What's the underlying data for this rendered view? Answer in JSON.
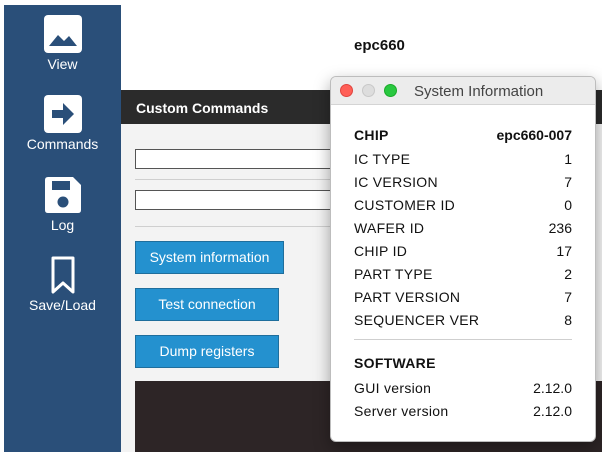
{
  "sidebar": {
    "items": [
      {
        "label": "View",
        "icon": "image-icon"
      },
      {
        "label": "Commands",
        "icon": "arrow-right-icon"
      },
      {
        "label": "Log",
        "icon": "floppy-disk-icon"
      },
      {
        "label": "Save/Load",
        "icon": "bookmark-icon"
      }
    ]
  },
  "device": {
    "name": "epc660"
  },
  "panel": {
    "title": "Custom Commands",
    "buttons": [
      {
        "label": "System information"
      },
      {
        "label": "Test connection"
      },
      {
        "label": "Dump registers"
      }
    ]
  },
  "sysinfo": {
    "window_title": "System Information",
    "chip_header": "CHIP",
    "chip_value": "epc660-007",
    "rows": [
      {
        "key": "IC TYPE",
        "value": "1"
      },
      {
        "key": "IC VERSION",
        "value": "7"
      },
      {
        "key": "CUSTOMER ID",
        "value": "0"
      },
      {
        "key": "WAFER ID",
        "value": "236"
      },
      {
        "key": "CHIP ID",
        "value": "17"
      },
      {
        "key": "PART TYPE",
        "value": "2"
      },
      {
        "key": "PART VERSION",
        "value": "7"
      },
      {
        "key": "SEQUENCER VER",
        "value": "8"
      }
    ],
    "software_header": "SOFTWARE",
    "software_rows": [
      {
        "key": "GUI version",
        "value": "2.12.0"
      },
      {
        "key": "Server version",
        "value": "2.12.0"
      }
    ]
  },
  "colors": {
    "sidebar": "#2a4f79",
    "button": "#2491cf",
    "panel_header": "#2b2b2b"
  }
}
